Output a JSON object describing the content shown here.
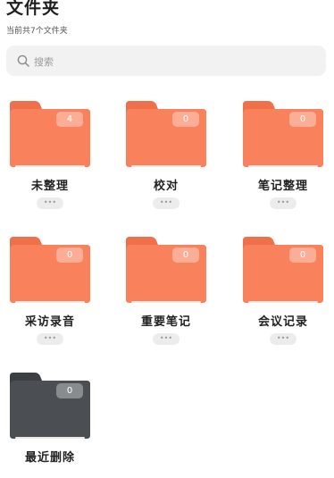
{
  "header": {
    "title": "文件夹",
    "subtitle": "当前共7个文件夹"
  },
  "search": {
    "placeholder": "搜索"
  },
  "colors": {
    "folder_orange": "#f9825c",
    "folder_tab": "#f0704a",
    "folder_trash": "#4b4f53"
  },
  "folders": [
    {
      "name": "未整理",
      "count": "4",
      "more": "•••",
      "icon": "folder-icon"
    },
    {
      "name": "校对",
      "count": "0",
      "more": "•••",
      "icon": "folder-icon"
    },
    {
      "name": "笔记整理",
      "count": "0",
      "more": "•••",
      "icon": "folder-icon"
    },
    {
      "name": "采访录音",
      "count": "0",
      "more": "•••",
      "icon": "folder-icon"
    },
    {
      "name": "重要笔记",
      "count": "0",
      "more": "•••",
      "icon": "folder-icon"
    },
    {
      "name": "会议记录",
      "count": "0",
      "more": "•••",
      "icon": "folder-icon"
    },
    {
      "name": "最近删除",
      "count": "0",
      "icon": "trash-folder-icon"
    }
  ]
}
